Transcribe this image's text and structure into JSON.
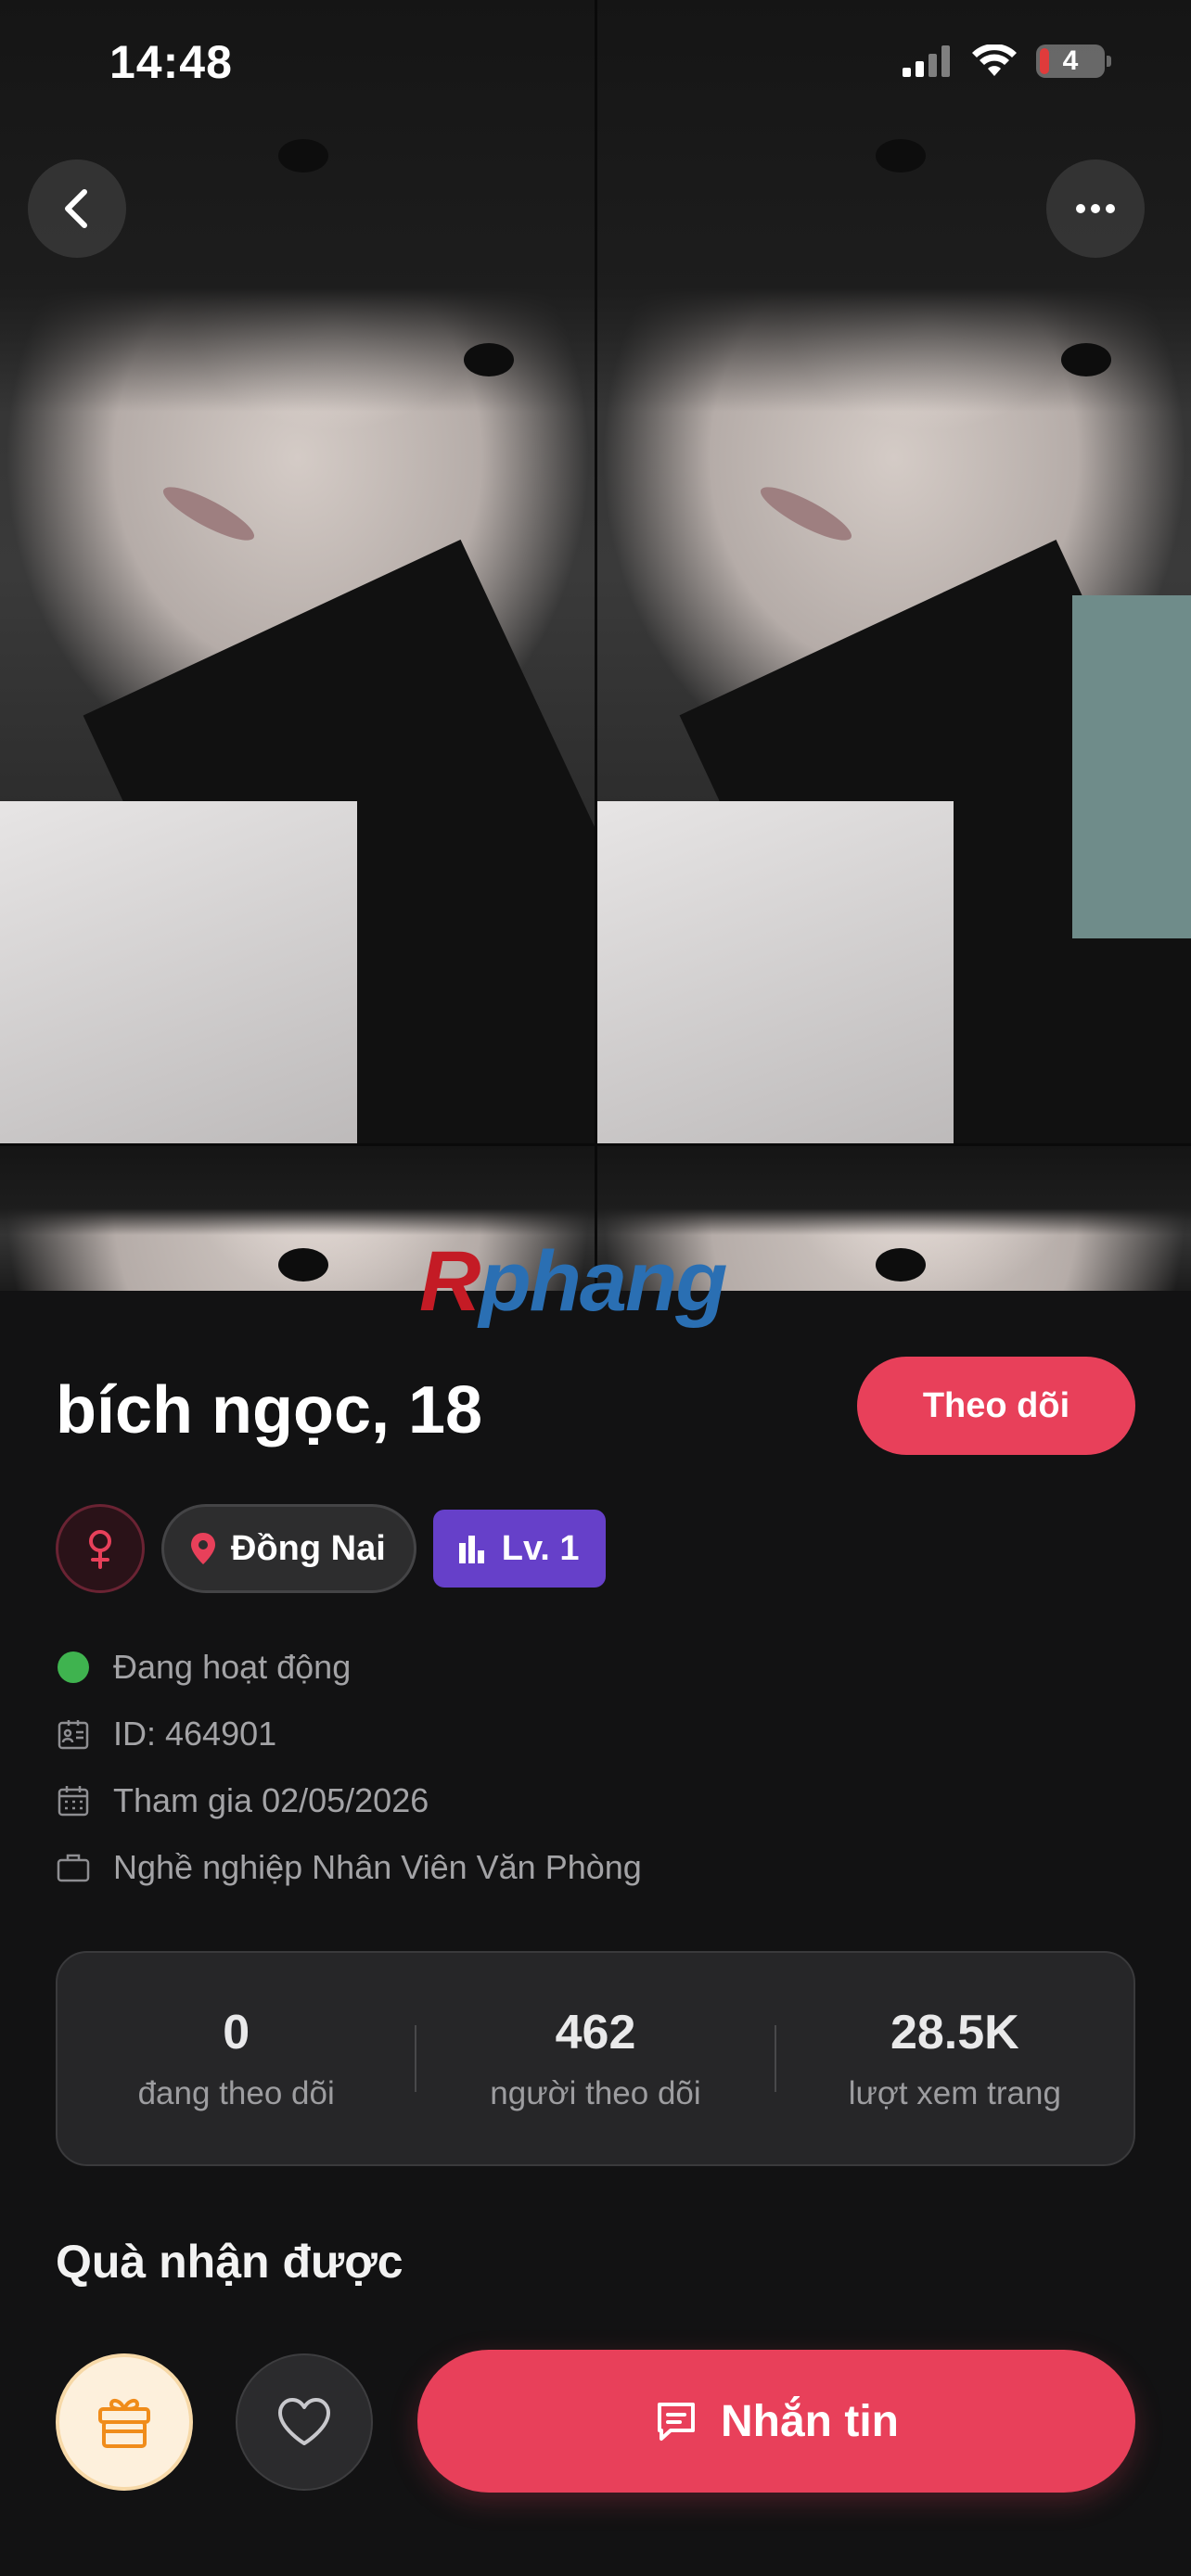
{
  "status_bar": {
    "time": "14:48",
    "battery": "4"
  },
  "profile": {
    "name_age": "bích ngọc, 18",
    "follow_label": "Theo dõi",
    "location": "Đồng Nai",
    "level": "Lv. 1",
    "status": "Đang hoạt động",
    "id_line": "ID: 464901",
    "joined": "Tham gia 02/05/2026",
    "job": "Nghề nghiệp Nhân Viên Văn Phòng"
  },
  "watermark": {
    "first": "R",
    "rest": "phang"
  },
  "stats": [
    {
      "value": "0",
      "label": "đang theo dõi"
    },
    {
      "value": "462",
      "label": "người theo dõi"
    },
    {
      "value": "28.5K",
      "label": "lượt xem trang"
    }
  ],
  "gifts": {
    "title": "Quà nhận được"
  },
  "actions": {
    "message_label": "Nhắn tin"
  },
  "colors": {
    "accent": "#e8405a",
    "level": "#6640c9",
    "online": "#3fb34f",
    "background": "#121213"
  },
  "icons": [
    "back-icon",
    "more-icon",
    "female-icon",
    "location-pin-icon",
    "bar-chart-icon",
    "id-card-icon",
    "calendar-icon",
    "briefcase-icon",
    "gift-icon",
    "heart-icon",
    "chat-icon"
  ]
}
